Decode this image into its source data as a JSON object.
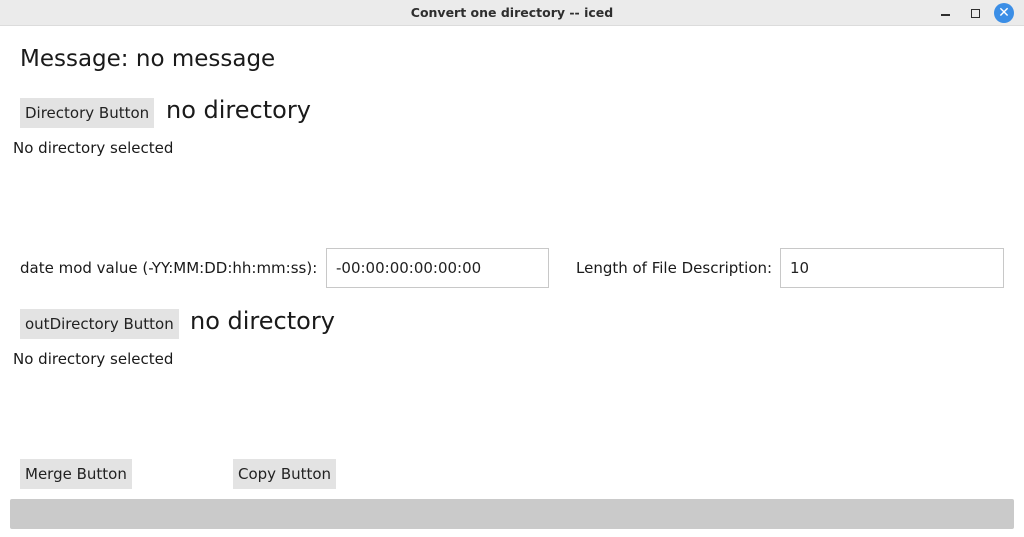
{
  "window": {
    "title": "Convert one directory -- iced"
  },
  "message": {
    "text": "Message:  no message"
  },
  "input_dir": {
    "button_label": "Directory Button",
    "path": "no directory",
    "status": "No directory selected"
  },
  "date_mod": {
    "label": "date mod value (-YY:MM:DD:hh:mm:ss):",
    "value": "-00:00:00:00:00:00"
  },
  "file_desc": {
    "label": "Length of File Description:",
    "value": "10"
  },
  "output_dir": {
    "button_label": "outDirectory Button",
    "path": "no directory",
    "status": "No directory selected"
  },
  "actions": {
    "merge_label": "Merge Button",
    "copy_label": "Copy Button"
  },
  "progress": {
    "fraction": 0
  }
}
